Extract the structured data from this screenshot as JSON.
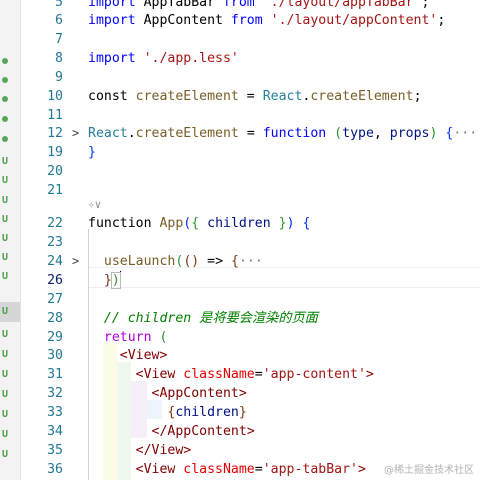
{
  "editor": {
    "lines": [
      {
        "num": "5",
        "fold": "",
        "tokens": [
          [
            "kw",
            "import "
          ],
          [
            "plain",
            "AppTabBar "
          ],
          [
            "kw",
            "from "
          ],
          [
            "str",
            "'./layout/appTabBar'"
          ],
          [
            "plain",
            ";"
          ]
        ]
      },
      {
        "num": "6",
        "fold": "",
        "tokens": [
          [
            "kw",
            "import "
          ],
          [
            "plain",
            "AppContent "
          ],
          [
            "kw",
            "from "
          ],
          [
            "str",
            "'./layout/appContent'"
          ],
          [
            "plain",
            ";"
          ]
        ]
      },
      {
        "num": "7",
        "fold": "",
        "tokens": []
      },
      {
        "num": "8",
        "fold": "",
        "tokens": [
          [
            "kw",
            "import "
          ],
          [
            "str",
            "'./app.less'"
          ]
        ]
      },
      {
        "num": "9",
        "fold": "",
        "tokens": []
      },
      {
        "num": "10",
        "fold": "",
        "tokens": [
          [
            "plain",
            "const "
          ],
          [
            "fn",
            "createElement"
          ],
          [
            "plain",
            " = "
          ],
          [
            "cls",
            "React"
          ],
          [
            "plain",
            "."
          ],
          [
            "fn",
            "createElement"
          ],
          [
            "plain",
            ";"
          ]
        ]
      },
      {
        "num": "11",
        "fold": "",
        "tokens": []
      },
      {
        "num": "12",
        "fold": ">",
        "tokens": [
          [
            "cls",
            "React"
          ],
          [
            "plain",
            "."
          ],
          [
            "fn",
            "createElement"
          ],
          [
            "plain",
            " = "
          ],
          [
            "kw",
            "function "
          ],
          [
            "br2",
            "("
          ],
          [
            "var",
            "type"
          ],
          [
            "plain",
            ", "
          ],
          [
            "var",
            "props"
          ],
          [
            "br2",
            ")"
          ],
          [
            "plain",
            " "
          ],
          [
            "br1",
            "{"
          ],
          [
            "ellip",
            "···"
          ]
        ]
      },
      {
        "num": "19",
        "fold": "",
        "tokens": [
          [
            "br1",
            "}"
          ]
        ]
      },
      {
        "num": "20",
        "fold": "",
        "tokens": []
      },
      {
        "num": "21",
        "fold": "",
        "tokens": []
      },
      {
        "num": "22",
        "fold": "",
        "tokens": [
          [
            "plain",
            "function "
          ],
          [
            "fn",
            "App"
          ],
          [
            "br1",
            "("
          ],
          [
            "br2",
            "{"
          ],
          [
            "plain",
            " "
          ],
          [
            "var",
            "children"
          ],
          [
            "plain",
            " "
          ],
          [
            "br2",
            "}"
          ],
          [
            "br1",
            ")"
          ],
          [
            "plain",
            " "
          ],
          [
            "br1",
            "{"
          ]
        ]
      },
      {
        "num": "23",
        "fold": "",
        "tokens": []
      },
      {
        "num": "24",
        "fold": ">",
        "tokens": [
          [
            "plain",
            "  "
          ],
          [
            "fn",
            "useLaunch"
          ],
          [
            "br2",
            "("
          ],
          [
            "br3",
            "("
          ],
          [
            "br3",
            ")"
          ],
          [
            "plain",
            " => "
          ],
          [
            "br3",
            "{"
          ],
          [
            "ellip",
            "···"
          ]
        ]
      },
      {
        "num": "26",
        "fold": "",
        "tokens": [
          [
            "plain",
            "  "
          ],
          [
            "br3",
            "}"
          ],
          [
            "br2",
            ")"
          ]
        ]
      },
      {
        "num": "27",
        "fold": "",
        "tokens": []
      },
      {
        "num": "28",
        "fold": "",
        "tokens": [
          [
            "plain",
            "  "
          ],
          [
            "cmt",
            "// children 是将要会渲染的页面"
          ]
        ]
      },
      {
        "num": "29",
        "fold": "",
        "tokens": [
          [
            "plain",
            "  "
          ],
          [
            "ctl",
            "return"
          ],
          [
            "plain",
            " "
          ],
          [
            "br2",
            "("
          ]
        ]
      },
      {
        "num": "30",
        "fold": "",
        "tokens": [
          [
            "plain",
            "    "
          ],
          [
            "tag",
            "<View"
          ],
          [
            "tag",
            ">"
          ]
        ]
      },
      {
        "num": "31",
        "fold": "",
        "tokens": [
          [
            "plain",
            "      "
          ],
          [
            "tag",
            "<View "
          ],
          [
            "attr",
            "className"
          ],
          [
            "plain",
            "="
          ],
          [
            "str",
            "'app-content'"
          ],
          [
            "tag",
            ">"
          ]
        ]
      },
      {
        "num": "32",
        "fold": "",
        "tokens": [
          [
            "plain",
            "        "
          ],
          [
            "tag",
            "<AppContent"
          ],
          [
            "tag",
            ">"
          ]
        ]
      },
      {
        "num": "33",
        "fold": "",
        "tokens": [
          [
            "plain",
            "          "
          ],
          [
            "br3",
            "{"
          ],
          [
            "var",
            "children"
          ],
          [
            "br3",
            "}"
          ]
        ]
      },
      {
        "num": "34",
        "fold": "",
        "tokens": [
          [
            "plain",
            "        "
          ],
          [
            "tag",
            "</AppContent"
          ],
          [
            "tag",
            ">"
          ]
        ]
      },
      {
        "num": "35",
        "fold": "",
        "tokens": [
          [
            "plain",
            "      "
          ],
          [
            "tag",
            "</View"
          ],
          [
            "tag",
            ">"
          ]
        ]
      },
      {
        "num": "36",
        "fold": "",
        "tokens": [
          [
            "plain",
            "      "
          ],
          [
            "tag",
            "<View "
          ],
          [
            "attr",
            "className"
          ],
          [
            "plain",
            "="
          ],
          [
            "str",
            "'app-tabBar'"
          ],
          [
            "tag",
            ">"
          ]
        ]
      }
    ],
    "active_line": "26",
    "codelens_icon": "sparkle-chevron-icon",
    "codelens_text": "✧∨"
  },
  "watermark": "@稀土掘金技术社区",
  "colors": {
    "line_number": "#237893",
    "keyword": "#0000ff",
    "string": "#a31515",
    "function": "#795e26"
  }
}
